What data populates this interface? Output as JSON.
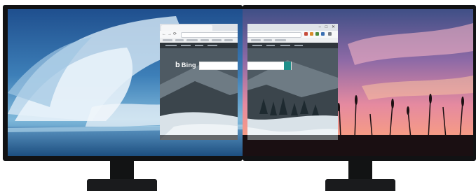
{
  "monitors": {
    "left": {
      "wallpaper": "blue-sky-clouds"
    },
    "right": {
      "wallpaper": "sunset-meadow-silhouette"
    }
  },
  "browser": {
    "tab_title": "",
    "controls": "– □ ✕",
    "nav": {
      "back": "←",
      "forward": "→",
      "refresh": "⟳"
    },
    "page": {
      "logo_text": "Bing",
      "logo_glyph": "b",
      "search_value": "",
      "search_button_glyph": "⌕"
    }
  },
  "colors": {
    "bezel": "#111214",
    "bing_accent": "#1f8f8a",
    "sky_top": "#1f4f8e",
    "sunset_top": "#3f4f86",
    "sunset_glow": "#f59a86"
  }
}
